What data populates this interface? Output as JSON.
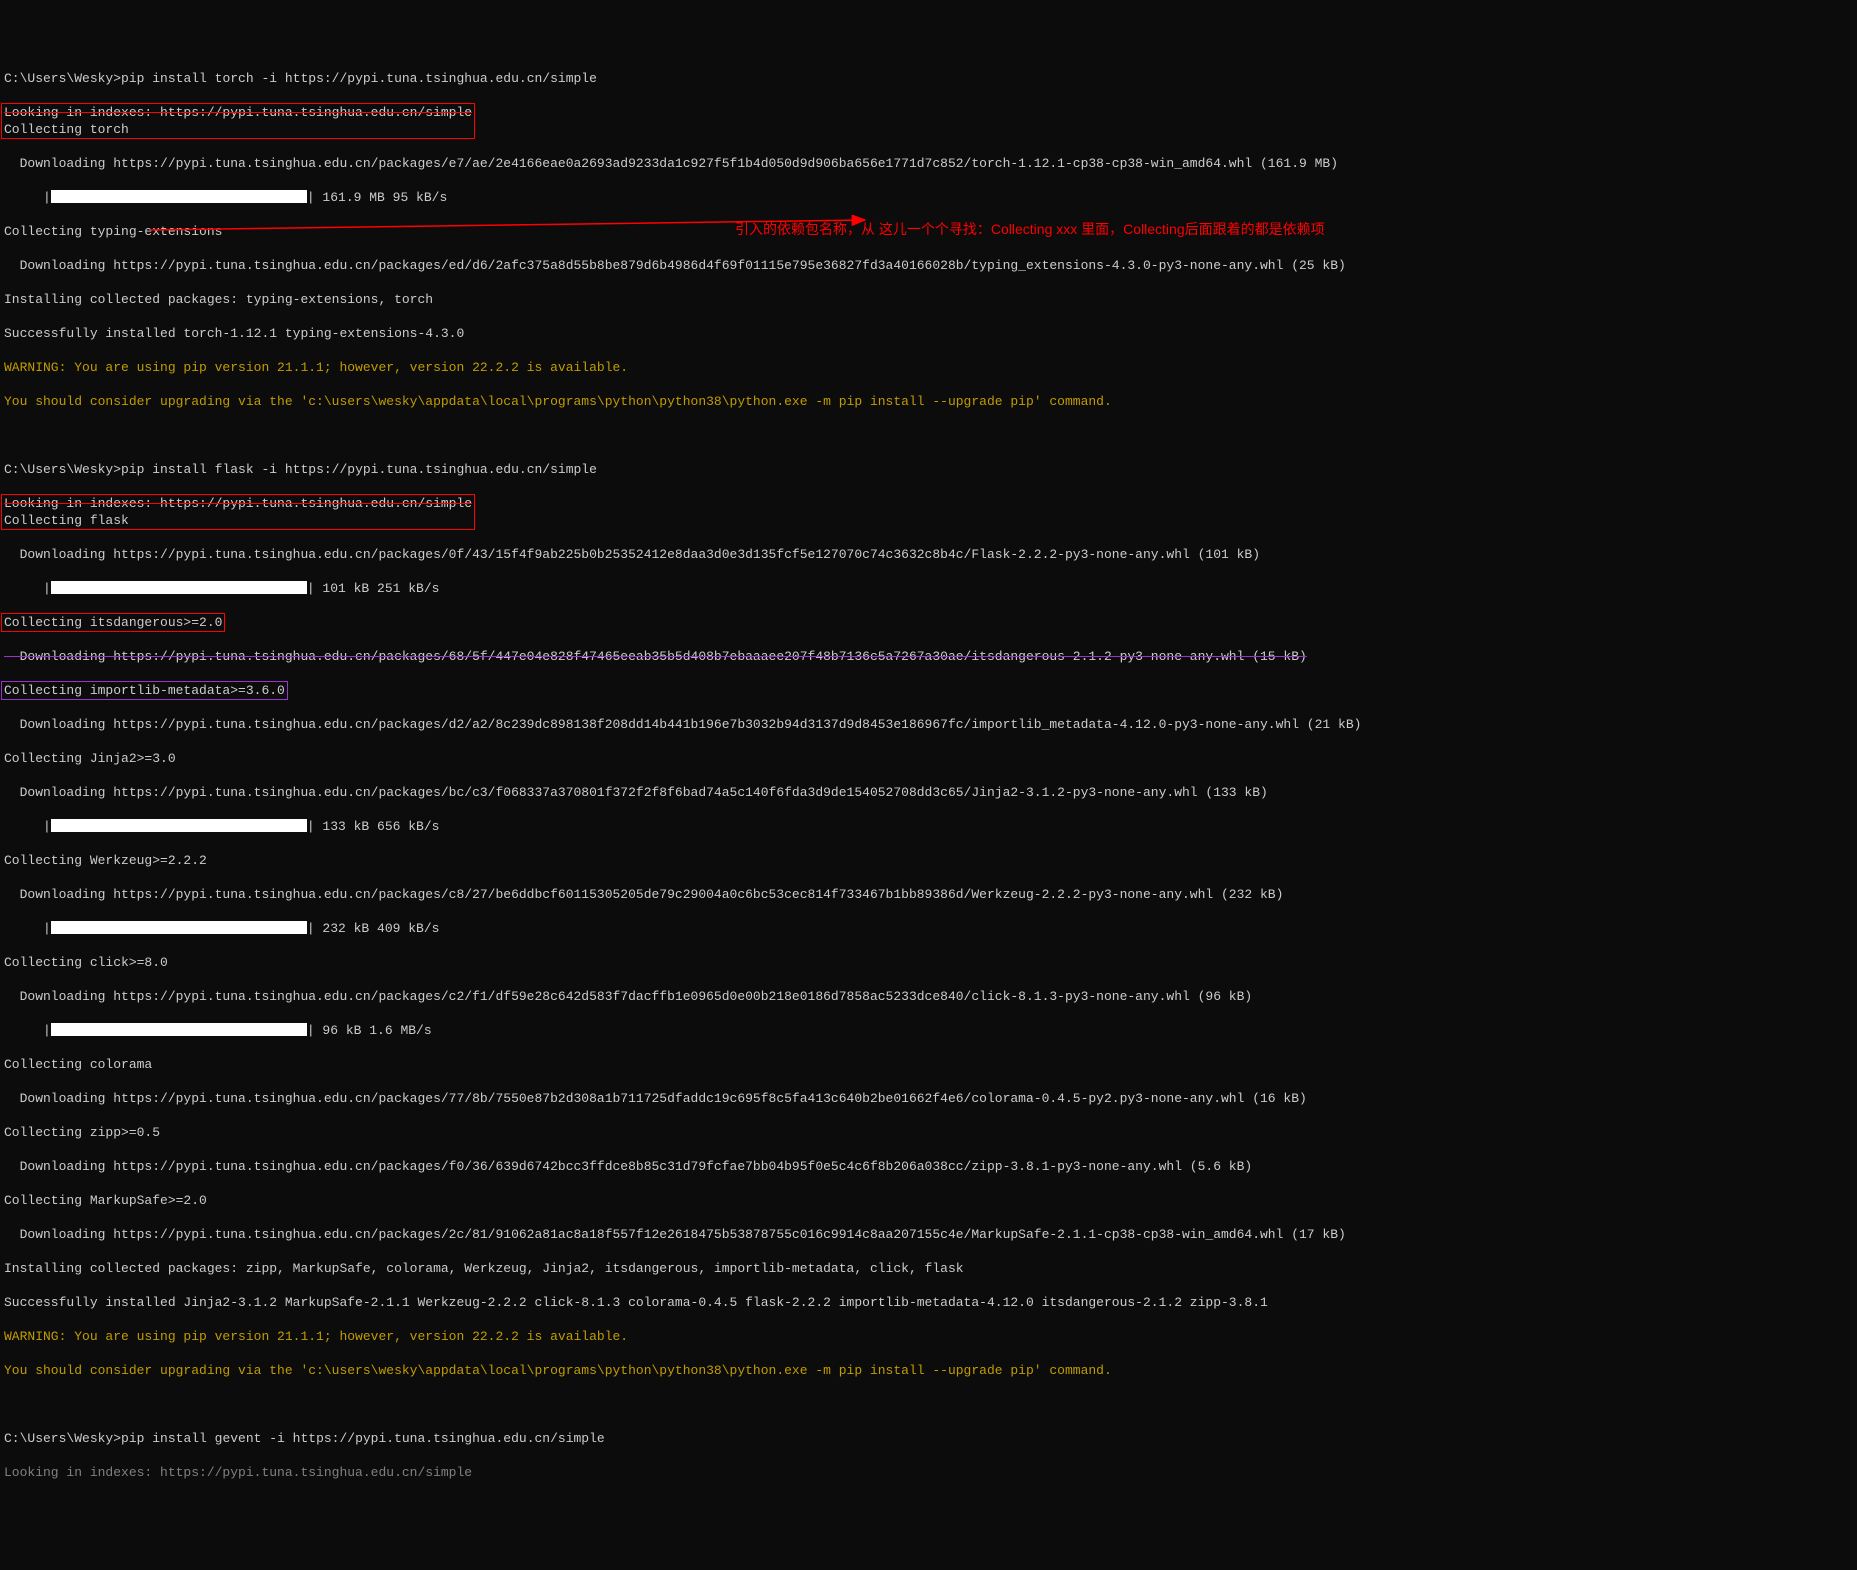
{
  "terminal": {
    "prompt_path": "C:\\Users\\Wesky>",
    "cmd_torch": "pip install torch -i https://pypi.tuna.tsinghua.edu.cn/simple",
    "cmd_flask": "pip install flask -i https://pypi.tuna.tsinghua.edu.cn/simple",
    "cmd_gevent": "pip install gevent -i https://pypi.tuna.tsinghua.edu.cn/simple",
    "looking_indexes": "Looking in indexes: https://pypi.tuna.tsinghua.edu.cn/simple",
    "collecting_torch": "Collecting torch",
    "dl_torch": "  Downloading https://pypi.tuna.tsinghua.edu.cn/packages/e7/ae/2e4166eae0a2693ad9233da1c927f5f1b4d050d9d906ba656e1771d7c852/torch-1.12.1-cp38-cp38-win_amd64.whl (161.9 MB)",
    "torch_speed": " 161.9 MB 95 kB/s",
    "collecting_typing": "Collecting typing-extensions",
    "dl_typing": "  Downloading https://pypi.tuna.tsinghua.edu.cn/packages/ed/d6/2afc375a8d55b8be879d6b4986d4f69f01115e795e36827fd3a40166028b/typing_extensions-4.3.0-py3-none-any.whl (25 kB)",
    "installing_torch": "Installing collected packages: typing-extensions, torch",
    "success_torch": "Successfully installed torch-1.12.1 typing-extensions-4.3.0",
    "warning_version": "WARNING: You are using pip version 21.1.1; however, version 22.2.2 is available.",
    "warning_upgrade": "You should consider upgrading via the 'c:\\users\\wesky\\appdata\\local\\programs\\python\\python38\\python.exe -m pip install --upgrade pip' command.",
    "collecting_flask": "Collecting flask",
    "dl_flask": "  Downloading https://pypi.tuna.tsinghua.edu.cn/packages/0f/43/15f4f9ab225b0b25352412e8daa3d0e3d135fcf5e127070c74c3632c8b4c/Flask-2.2.2-py3-none-any.whl (101 kB)",
    "flask_speed": " 101 kB 251 kB/s",
    "collecting_itsdangerous": "Collecting itsdangerous>=2.0",
    "dl_itsdangerous": "  Downloading https://pypi.tuna.tsinghua.edu.cn/packages/68/5f/447e04e828f47465eeab35b5d408b7ebaaaee207f48b7136c5a7267a30ae/itsdangerous-2.1.2-py3-none-any.whl (15 kB)",
    "collecting_importlib": "Collecting importlib-metadata>=3.6.0",
    "dl_importlib": "  Downloading https://pypi.tuna.tsinghua.edu.cn/packages/d2/a2/8c239dc898138f208dd14b441b196e7b3032b94d3137d9d8453e186967fc/importlib_metadata-4.12.0-py3-none-any.whl (21 kB)",
    "collecting_jinja": "Collecting Jinja2>=3.0",
    "dl_jinja": "  Downloading https://pypi.tuna.tsinghua.edu.cn/packages/bc/c3/f068337a370801f372f2f8f6bad74a5c140f6fda3d9de154052708dd3c65/Jinja2-3.1.2-py3-none-any.whl (133 kB)",
    "jinja_speed": " 133 kB 656 kB/s",
    "collecting_werkzeug": "Collecting Werkzeug>=2.2.2",
    "dl_werkzeug": "  Downloading https://pypi.tuna.tsinghua.edu.cn/packages/c8/27/be6ddbcf60115305205de79c29004a0c6bc53cec814f733467b1bb89386d/Werkzeug-2.2.2-py3-none-any.whl (232 kB)",
    "werkzeug_speed": " 232 kB 409 kB/s",
    "collecting_click": "Collecting click>=8.0",
    "dl_click": "  Downloading https://pypi.tuna.tsinghua.edu.cn/packages/c2/f1/df59e28c642d583f7dacffb1e0965d0e00b218e0186d7858ac5233dce840/click-8.1.3-py3-none-any.whl (96 kB)",
    "click_speed": " 96 kB 1.6 MB/s",
    "collecting_colorama": "Collecting colorama",
    "dl_colorama": "  Downloading https://pypi.tuna.tsinghua.edu.cn/packages/77/8b/7550e87b2d308a1b711725dfaddc19c695f8c5fa413c640b2be01662f4e6/colorama-0.4.5-py2.py3-none-any.whl (16 kB)",
    "collecting_zipp": "Collecting zipp>=0.5",
    "dl_zipp": "  Downloading https://pypi.tuna.tsinghua.edu.cn/packages/f0/36/639d6742bcc3ffdce8b85c31d79fcfae7bb04b95f0e5c4c6f8b206a038cc/zipp-3.8.1-py3-none-any.whl (5.6 kB)",
    "collecting_markupsafe": "Collecting MarkupSafe>=2.0",
    "dl_markupsafe": "  Downloading https://pypi.tuna.tsinghua.edu.cn/packages/2c/81/91062a81ac8a18f557f12e2618475b53878755c016c9914c8aa207155c4e/MarkupSafe-2.1.1-cp38-cp38-win_amd64.whl (17 kB)",
    "installing_flask": "Installing collected packages: zipp, MarkupSafe, colorama, Werkzeug, Jinja2, itsdangerous, importlib-metadata, click, flask",
    "success_flask": "Successfully installed Jinja2-3.1.2 MarkupSafe-2.1.1 Werkzeug-2.2.2 click-8.1.3 colorama-0.4.5 flask-2.2.2 importlib-metadata-4.12.0 itsdangerous-2.1.2 zipp-3.8.1"
  },
  "annotation": {
    "text": "引入的依赖包名称，从 这儿一个个寻找：Collecting xxx 里面，Collecting后面跟着的都是依赖项"
  }
}
